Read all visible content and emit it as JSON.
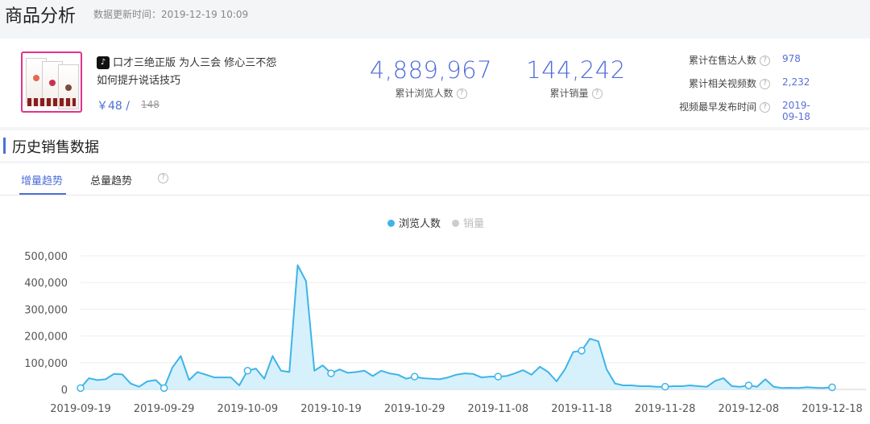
{
  "header": {
    "title": "商品分析",
    "update_label": "数据更新时间：2019-12-19 10:09"
  },
  "product": {
    "platform_icon": "tiktok-icon",
    "name": "口才三绝正版 为人三会 修心三不怨 如何提升说话技巧",
    "price": "￥48 /",
    "original_price": "148"
  },
  "stats": {
    "views": {
      "value": "4,889,967",
      "label": "累计浏览人数"
    },
    "sales": {
      "value": "144,242",
      "label": "累计销量"
    }
  },
  "side_stats": [
    {
      "label": "累计在售达人数",
      "value": "978"
    },
    {
      "label": "累计相关视频数",
      "value": "2,232"
    },
    {
      "label": "视频最早发布时间",
      "value": "2019-09-18"
    }
  ],
  "section": {
    "title": "历史销售数据"
  },
  "tabs": [
    {
      "label": "增量趋势",
      "active": true
    },
    {
      "label": "总量趋势",
      "active": false
    }
  ],
  "help_icon": "question-circle-icon",
  "colors": {
    "accent": "#4e6fd8",
    "series_line": "#3fb4e8",
    "series_fill": "#cfeefb",
    "legend_inactive": "#cccccc"
  },
  "chart_data": {
    "type": "area",
    "legend": [
      {
        "name": "浏览人数",
        "active": true
      },
      {
        "name": "销量",
        "active": false
      }
    ],
    "x_ticks": [
      "2019-09-19",
      "2019-09-29",
      "2019-10-09",
      "2019-10-19",
      "2019-10-29",
      "2019-11-08",
      "2019-11-18",
      "2019-11-28",
      "2019-12-08",
      "2019-12-18"
    ],
    "y_ticks": [
      "0",
      "100,000",
      "200,000",
      "300,000",
      "400,000",
      "500,000"
    ],
    "ylim": [
      0,
      500000
    ],
    "x_start": "2019-09-19",
    "x_end": "2019-12-18",
    "series": [
      {
        "name": "浏览人数",
        "values": [
          5000,
          42000,
          35000,
          38000,
          58000,
          56000,
          22000,
          10000,
          30000,
          35000,
          5000,
          82000,
          125000,
          35000,
          65000,
          55000,
          45000,
          45000,
          45000,
          15000,
          70000,
          78000,
          40000,
          125000,
          70000,
          65000,
          465000,
          405000,
          70000,
          90000,
          60000,
          75000,
          62000,
          65000,
          70000,
          50000,
          70000,
          60000,
          55000,
          40000,
          48000,
          42000,
          40000,
          38000,
          45000,
          55000,
          60000,
          58000,
          45000,
          48000,
          48000,
          50000,
          60000,
          72000,
          55000,
          85000,
          65000,
          30000,
          75000,
          140000,
          145000,
          190000,
          180000,
          75000,
          22000,
          15000,
          15000,
          12000,
          12000,
          10000,
          10000,
          12000,
          12000,
          15000,
          12000,
          10000,
          32000,
          42000,
          12000,
          10000,
          15000,
          10000,
          38000,
          10000,
          5000,
          6000,
          5000,
          8000,
          6000,
          5000,
          8000
        ],
        "marker_indices": [
          0,
          10,
          20,
          30,
          40,
          50,
          60,
          70,
          80,
          90
        ]
      }
    ]
  }
}
